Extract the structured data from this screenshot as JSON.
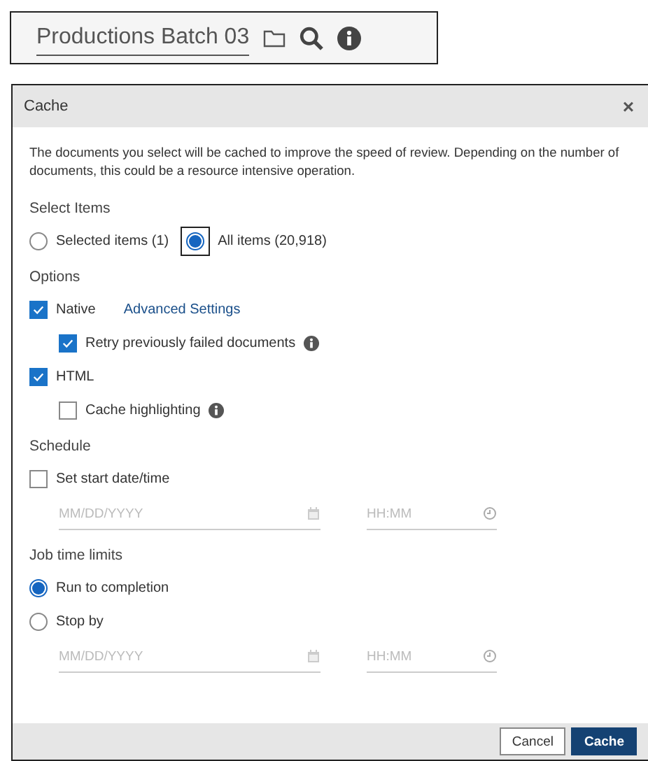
{
  "header": {
    "title": "Productions Batch 03"
  },
  "dialog": {
    "title": "Cache",
    "close": "×",
    "description": "The documents you select will be cached to improve the speed of review. Depending on the number of documents, this could be a resource intensive operation.",
    "sections": [
      {
        "label": "Select Items",
        "inline": true,
        "items": [
          {
            "kind": "radio",
            "label": "Selected items (1)",
            "selected": false,
            "focused": false
          },
          {
            "kind": "radio",
            "label": "All items (20,918)",
            "selected": true,
            "focused": true
          }
        ]
      },
      {
        "label": "Options",
        "inline": false,
        "items": [
          {
            "kind": "checkbox",
            "label": "Native",
            "checked": true,
            "link": "Advanced Settings",
            "info": false,
            "children": [
              {
                "kind": "checkbox",
                "label": "Retry previously failed documents",
                "checked": true,
                "info": true
              }
            ]
          },
          {
            "kind": "checkbox",
            "label": "HTML",
            "checked": true,
            "info": false,
            "children": [
              {
                "kind": "checkbox",
                "label": "Cache highlighting",
                "checked": false,
                "info": true
              }
            ]
          }
        ]
      },
      {
        "label": "Schedule",
        "inline": false,
        "items": [
          {
            "kind": "checkbox",
            "label": "Set start date/time",
            "checked": false,
            "info": false
          },
          {
            "kind": "datetime",
            "date_placeholder": "MM/DD/YYYY",
            "time_placeholder": "HH:MM"
          }
        ]
      },
      {
        "label": "Job time limits",
        "inline": false,
        "items": [
          {
            "kind": "radio",
            "label": "Run to completion",
            "selected": true,
            "focused": false
          },
          {
            "kind": "radio",
            "label": "Stop by",
            "selected": false,
            "focused": false
          },
          {
            "kind": "datetime",
            "date_placeholder": "MM/DD/YYYY",
            "time_placeholder": "HH:MM"
          }
        ]
      }
    ],
    "buttons": [
      {
        "label": "Cancel",
        "primary": false
      },
      {
        "label": "Cache",
        "primary": true
      }
    ]
  }
}
